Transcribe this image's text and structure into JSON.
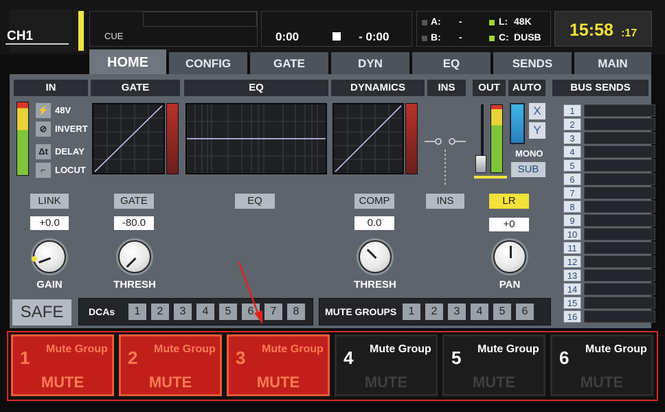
{
  "channel": {
    "name": "CH1",
    "cue_label": "CUE"
  },
  "transport": {
    "time_elapsed": "0:00",
    "time_remaining": "- 0:00"
  },
  "status": {
    "a_label": "A:",
    "a_value": "-",
    "b_label": "B:",
    "b_value": "-",
    "l_label": "L:",
    "l_value": "48K",
    "c_label": "C:",
    "c_value": "DUSB"
  },
  "clock": {
    "hm": "15:58",
    "sec": ":17"
  },
  "tabs": [
    "HOME",
    "CONFIG",
    "GATE",
    "DYN",
    "EQ",
    "SENDS",
    "MAIN"
  ],
  "sections": {
    "in": "IN",
    "gate": "GATE",
    "eq": "EQ",
    "dynamics": "DYNAMICS",
    "ins": "INS",
    "out": "OUT",
    "auto": "AUTO",
    "bus_sends": "BUS SENDS"
  },
  "in_options": [
    "48V",
    "INVERT",
    "DELAY",
    "LOCUT"
  ],
  "auto": {
    "x": "X",
    "y": "Y",
    "mono": "MONO",
    "sub": "SUB"
  },
  "controls": {
    "link": {
      "label": "LINK",
      "value": "+0.0",
      "knob_label": "GAIN"
    },
    "gate": {
      "label": "GATE",
      "value": "-80.0",
      "knob_label": "THRESH"
    },
    "eq": {
      "label": "EQ"
    },
    "comp": {
      "label": "COMP",
      "value": "0.0",
      "knob_label": "THRESH"
    },
    "ins": {
      "label": "INS"
    },
    "lr": {
      "label": "LR",
      "value": "+0",
      "knob_label": "PAN"
    }
  },
  "safe_label": "SAFE",
  "dcas": {
    "label": "DCAs",
    "items": [
      "1",
      "2",
      "3",
      "4",
      "5",
      "6",
      "7",
      "8"
    ]
  },
  "mute_groups": {
    "label": "MUTE GROUPS",
    "items": [
      "1",
      "2",
      "3",
      "4",
      "5",
      "6"
    ]
  },
  "bus_sends": [
    "1",
    "2",
    "3",
    "4",
    "5",
    "6",
    "7",
    "8",
    "9",
    "10",
    "11",
    "12",
    "13",
    "14",
    "15",
    "16"
  ],
  "mute_buttons": [
    {
      "num": "1",
      "title": "Mute Group",
      "label": "MUTE",
      "active": true
    },
    {
      "num": "2",
      "title": "Mute Group",
      "label": "MUTE",
      "active": true
    },
    {
      "num": "3",
      "title": "Mute Group",
      "label": "MUTE",
      "active": true
    },
    {
      "num": "4",
      "title": "Mute Group",
      "label": "MUTE",
      "active": false
    },
    {
      "num": "5",
      "title": "Mute Group",
      "label": "MUTE",
      "active": false
    },
    {
      "num": "6",
      "title": "Mute Group",
      "label": "MUTE",
      "active": false
    }
  ],
  "colors": {
    "clock": "#f3e23a",
    "mute_on": "#c11f1b",
    "mute_border": "#d82a24",
    "lr_active": "#f3e23a"
  }
}
